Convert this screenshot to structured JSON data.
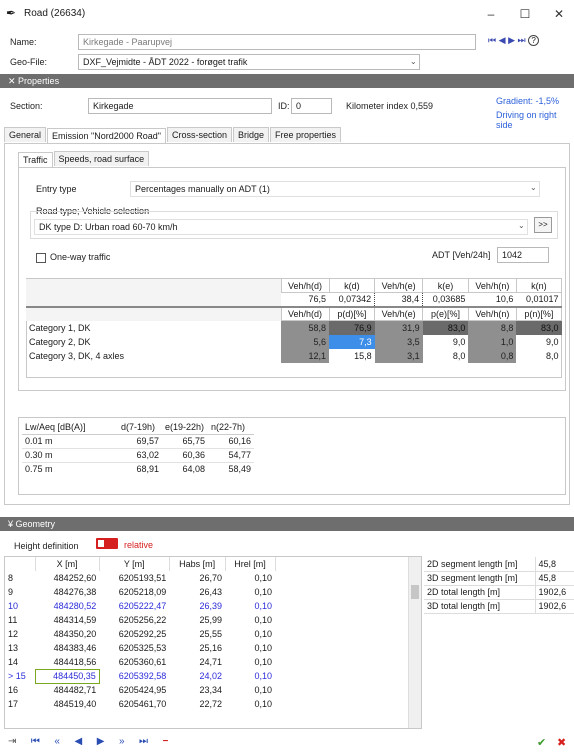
{
  "window": {
    "title": "Road (26634)",
    "minimize": "–",
    "maximize": "☐",
    "close": "✕"
  },
  "form": {
    "name_label": "Name:",
    "name_value": "Kirkegade - Paarupvej",
    "geofile_label": "Geo-File:",
    "geofile_value": "DXF_Vejmidte - ÅDT 2022 - forøget trafik",
    "nav": [
      "⏮",
      "◀",
      "▶",
      "⏭"
    ],
    "help": "?"
  },
  "properties": {
    "header": "Properties",
    "section_label": "Section:",
    "section_value": "Kirkegade",
    "id_label": "ID:",
    "id_value": "0",
    "km_label": "Kilometer index 0,559",
    "gradient": "Gradient: -1,5%",
    "driving": "Driving on right side"
  },
  "tabs": [
    "General",
    "Emission \"Nord2000 Road\"",
    "Cross-section",
    "Bridge",
    "Free properties"
  ],
  "subtabs": [
    "Traffic",
    "Speeds, road surface"
  ],
  "traffic": {
    "entry_label": "Entry type",
    "entry_value": "Percentages manually on ADT (1)",
    "roadtype_label": "Road type; Vehicle selection",
    "roadtype_value": "DK type D: Urban road 60-70 km/h",
    "more_btn": ">>",
    "oneway_label": "One-way traffic",
    "adt_label": "ADT [Veh/24h]",
    "adt_value": "1042",
    "head1": [
      "Veh/h(d)",
      "k(d)",
      "Veh/h(e)",
      "k(e)",
      "Veh/h(n)",
      "k(n)"
    ],
    "vals1": [
      "76,5",
      "0,07342",
      "38,4",
      "0,03685",
      "10,6",
      "0,01017"
    ],
    "head2": [
      "Veh/h(d)",
      "p(d)[%]",
      "Veh/h(e)",
      "p(e)[%]",
      "Veh/h(n)",
      "p(n)[%]"
    ],
    "categories": [
      {
        "name": "Category 1, DK",
        "values": [
          "58,8",
          "76,9",
          "31,9",
          "83,0",
          "8,8",
          "83,0"
        ]
      },
      {
        "name": "Category 2, DK",
        "values": [
          "5,6",
          "7,3",
          "3,5",
          "9,0",
          "1,0",
          "9,0"
        ]
      },
      {
        "name": "Category 3, DK, 4 axles",
        "values": [
          "12,1",
          "15,8",
          "3,1",
          "8,0",
          "0,8",
          "8,0"
        ]
      }
    ]
  },
  "lw": {
    "head": [
      "Lw/Aeq [dB(A)]",
      "d(7-19h)",
      "e(19-22h)",
      "n(22-7h)"
    ],
    "rows": [
      [
        "0.01 m",
        "69,57",
        "65,75",
        "60,16"
      ],
      [
        "0.30 m",
        "63,02",
        "60,36",
        "54,77"
      ],
      [
        "0.75 m",
        "68,91",
        "64,08",
        "58,49"
      ]
    ]
  },
  "geometry": {
    "header": "Geometry",
    "height_def_label": "Height definition",
    "relative_label": "relative",
    "cols": [
      "X [m]",
      "Y [m]",
      "Habs [m]",
      "Hrel [m]"
    ],
    "rows": [
      {
        "idx": "8",
        "x": "484252,60",
        "y": "6205193,51",
        "habs": "26,70",
        "hrel": "0,10"
      },
      {
        "idx": "9",
        "x": "484276,38",
        "y": "6205218,09",
        "habs": "26,43",
        "hrel": "0,10"
      },
      {
        "idx": "10",
        "x": "484280,52",
        "y": "6205222,47",
        "habs": "26,39",
        "hrel": "0,10"
      },
      {
        "idx": "11",
        "x": "484314,59",
        "y": "6205256,22",
        "habs": "25,99",
        "hrel": "0,10"
      },
      {
        "idx": "12",
        "x": "484350,20",
        "y": "6205292,25",
        "habs": "25,55",
        "hrel": "0,10"
      },
      {
        "idx": "13",
        "x": "484383,46",
        "y": "6205325,53",
        "habs": "25,16",
        "hrel": "0,10"
      },
      {
        "idx": "14",
        "x": "484418,56",
        "y": "6205360,61",
        "habs": "24,71",
        "hrel": "0,10"
      },
      {
        "idx": "> 15",
        "x": "484450,35",
        "y": "6205392,58",
        "habs": "24,02",
        "hrel": "0,10"
      },
      {
        "idx": "16",
        "x": "484482,71",
        "y": "6205424,95",
        "habs": "23,34",
        "hrel": "0,10"
      },
      {
        "idx": "17",
        "x": "484519,40",
        "y": "6205461,70",
        "habs": "22,72",
        "hrel": "0,10"
      }
    ],
    "lengths": [
      {
        "label": "2D segment length [m]",
        "value": "45,8"
      },
      {
        "label": "3D segment length [m]",
        "value": "45,8"
      },
      {
        "label": "2D total length [m]",
        "value": "1902,6"
      },
      {
        "label": "3D total length [m]",
        "value": "1902,6"
      }
    ]
  },
  "footer": {
    "ok": "✔",
    "cancel": "✖"
  },
  "colors": {
    "accent": "#3b4ab0",
    "section_bg": "#6e6e6e",
    "selected_cell": "#3d8ee8",
    "toggle": "#d62020"
  }
}
